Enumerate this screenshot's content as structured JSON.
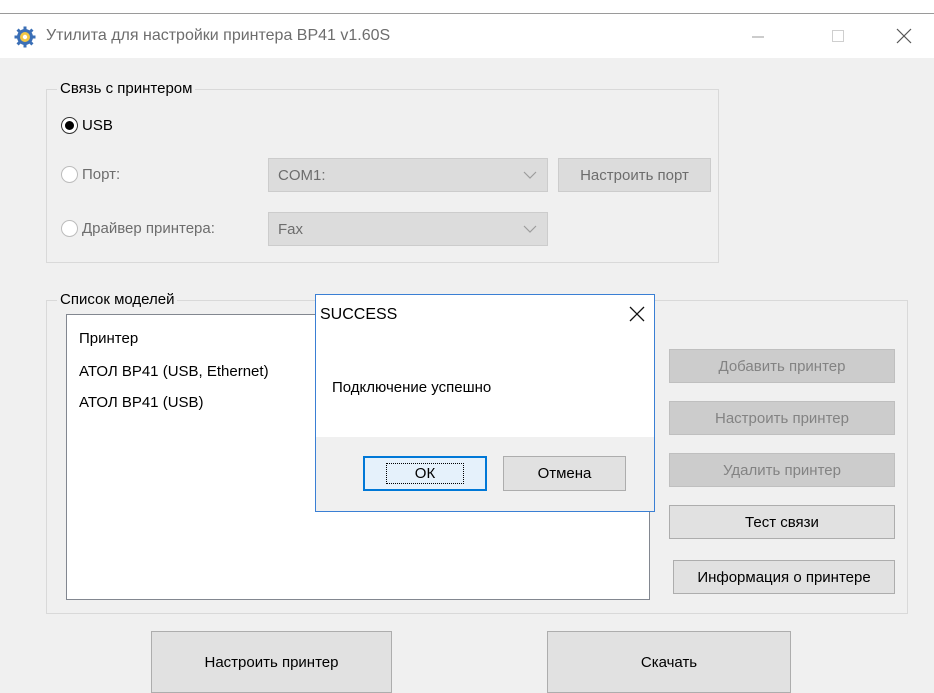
{
  "window": {
    "title": "Утилита для настройки принтера BP41 v1.60S",
    "icon": "gear-icon"
  },
  "connection": {
    "group_title": "Связь с принтером",
    "usb_label": "USB",
    "usb_selected": true,
    "port_label": "Порт:",
    "port_value": "COM1:",
    "configure_port_label": "Настроить порт",
    "driver_label": "Драйвер принтера:",
    "driver_value": "Fax"
  },
  "models": {
    "group_title": "Список моделей",
    "list_header": "Принтер",
    "items": [
      "АТОЛ BP41 (USB, Ethernet)",
      "АТОЛ BP41 (USB)"
    ],
    "add_label": "Добавить принтер",
    "configure_label": "Настроить принтер",
    "delete_label": "Удалить принтер",
    "test_label": "Тест связи",
    "info_label": "Информация о принтере"
  },
  "bottom": {
    "configure_printer_label": "Настроить принтер",
    "download_label": "Скачать"
  },
  "dialog": {
    "title": "SUCCESS",
    "message": "Подключение успешно",
    "ok_label": "ОК",
    "cancel_label": "Отмена"
  },
  "colors": {
    "dialog_border": "#3a7fd4",
    "focus_blue": "#0078d7",
    "disabled_text": "#6d6d6d"
  }
}
